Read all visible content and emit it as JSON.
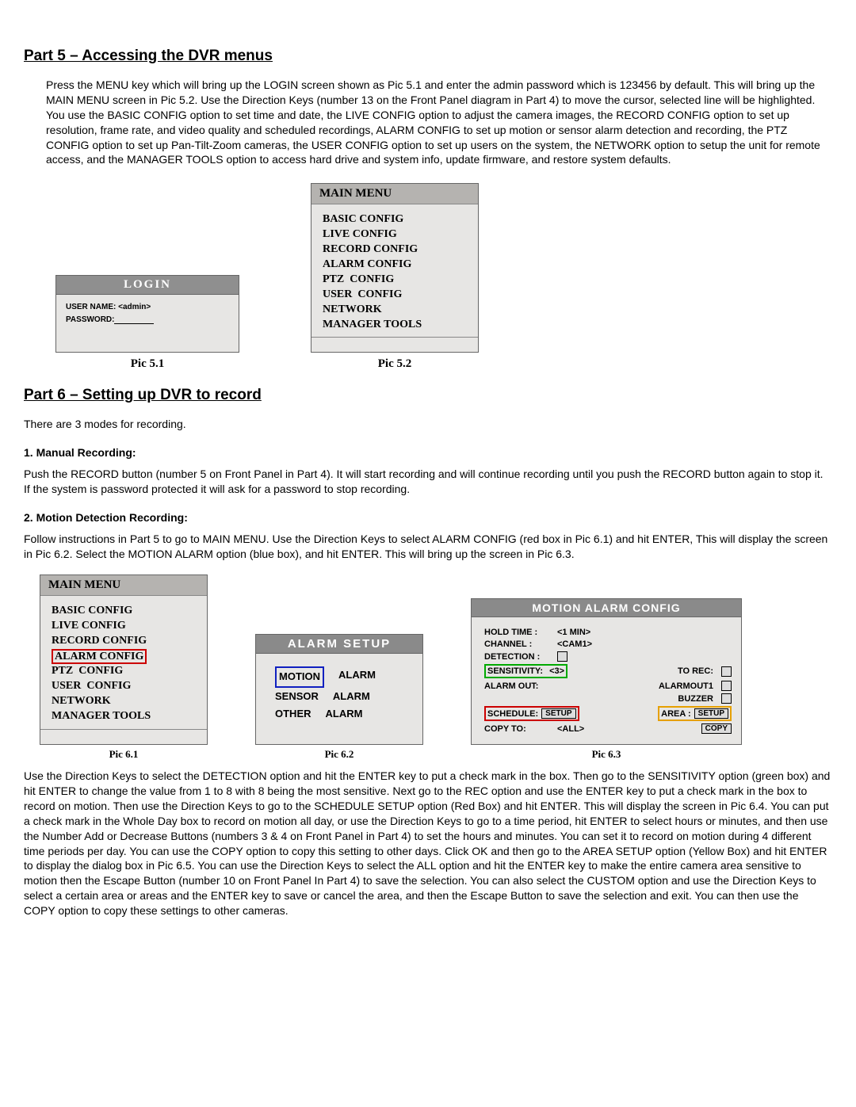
{
  "part5": {
    "heading": "Part 5 – Accessing the DVR menus",
    "body": "Press the MENU key which will bring up the LOGIN screen shown as Pic 5.1 and enter the admin password which is 123456 by default. This will bring up the MAIN MENU screen in Pic 5.2. Use the Direction Keys (number 13 on the Front Panel diagram in Part 4) to move the cursor, selected line will be highlighted. You use the BASIC CONFIG option to set time and date, the LIVE CONFIG option to adjust the camera images, the RECORD CONFIG option to set up resolution, frame rate, and video quality and scheduled recordings, ALARM CONFIG to set up motion or sensor alarm detection and recording, the PTZ CONFIG option to set up Pan-Tilt-Zoom cameras, the USER CONFIG option to set up users on the system, the NETWORK option to setup the unit for remote access, and the MANAGER TOOLS option to access hard drive and system info, update firmware, and restore system defaults."
  },
  "login": {
    "title": "LOGIN",
    "username_label": "USER NAME:",
    "username_value": "<admin>",
    "password_label": "PASSWORD:",
    "caption": "Pic 5.1"
  },
  "mainmenu": {
    "title": "MAIN MENU",
    "items": [
      "BASIC CONFIG",
      "LIVE CONFIG",
      "RECORD CONFIG",
      "ALARM CONFIG",
      "PTZ  CONFIG",
      "USER  CONFIG",
      "NETWORK",
      "MANAGER TOOLS"
    ],
    "caption": "Pic 5.2"
  },
  "part6": {
    "heading": "Part 6 – Setting up DVR to record",
    "intro": "There are 3 modes for recording.",
    "manual_heading": "1. Manual Recording:",
    "manual_body": " Push the RECORD button (number 5 on Front Panel in Part 4). It will start recording and will continue recording until you push the RECORD button again to stop it. If the system is password protected it will ask for a password to stop recording.",
    "motion_heading": "2. Motion Detection Recording:",
    "motion_body1": "Follow instructions in Part 5 to go to MAIN MENU. Use the Direction Keys to select ALARM CONFIG (red box in Pic 6.1) and hit ENTER, This will display the screen in Pic 6.2. Select the MOTION ALARM option (blue box), and hit ENTER. This will bring up the screen in Pic 6.3.",
    "motion_body2": "Use the Direction Keys to select the DETECTION option and hit the ENTER key to put a check mark in the box. Then go to the SENSITIVITY option (green box) and hit ENTER to change the value from 1 to 8 with 8 being the most sensitive. Next go to the REC option and use the ENTER key to put a check mark in the box to record on motion. Then use the Direction Keys to go to the SCHEDULE SETUP option (Red Box) and hit ENTER. This will display the screen in Pic 6.4. You can put a check mark in the Whole Day box to record on motion all day, or use the Direction Keys to go to a time period, hit ENTER to select hours or minutes, and then use the Number Add or Decrease Buttons (numbers 3 & 4 on Front Panel in Part 4) to set the hours and minutes. You can set it to record on motion during 4 different time periods per day. You can use the COPY option to copy this setting to other days. Click OK and then go to the AREA SETUP option (Yellow Box) and hit ENTER to display the dialog box in Pic 6.5. You can use the Direction Keys to select the ALL option and hit the ENTER key to make the entire camera area sensitive to motion then the Escape Button (number 10 on Front Panel In Part 4) to save the selection. You can also select the CUSTOM option and use the Direction Keys to select a certain area or areas and the ENTER key to save or cancel the area, and then the Escape Button to save the selection and exit. You can then use the COPY option to copy these settings to other cameras."
  },
  "mainmenu61": {
    "caption": "Pic 6.1"
  },
  "alarmsetup": {
    "title": "ALARM  SETUP",
    "rows": [
      {
        "left": "MOTION",
        "right": "ALARM"
      },
      {
        "left": "SENSOR",
        "right": "ALARM"
      },
      {
        "left": "OTHER",
        "right": "ALARM"
      }
    ],
    "caption": "Pic 6.2"
  },
  "mac": {
    "title": "MOTION ALARM CONFIG",
    "hold_time_label": "HOLD   TIME :",
    "hold_time_value": "<1 MIN>",
    "channel_label": "CHANNEL    :",
    "channel_value": "<CAM1>",
    "detection_label": "DETECTION :",
    "sensitivity_label": "SENSITIVITY:",
    "sensitivity_value": "<3>",
    "to_rec_label": "TO  REC:",
    "alarm_out_label": "ALARM   OUT:",
    "alarmout1": "ALARMOUT1",
    "buzzer": "BUZZER",
    "schedule_label": "SCHEDULE:",
    "area_label": "AREA :",
    "setup": "SETUP",
    "copyto_label": "COPY TO:",
    "copyto_value": "<ALL>",
    "copy": "COPY",
    "caption": "Pic 6.3"
  }
}
